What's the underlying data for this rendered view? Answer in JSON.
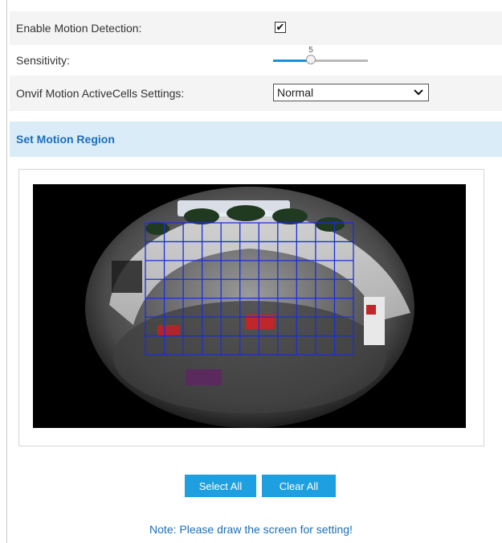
{
  "settings": {
    "motion_detection": {
      "label": "Enable Motion Detection:",
      "checked": true,
      "check_glyph": "✔"
    },
    "sensitivity": {
      "label": "Sensitivity:",
      "value": "5",
      "fraction": 0.4
    },
    "onvif_cells": {
      "label": "Onvif Motion ActiveCells Settings:",
      "selected": "Normal"
    }
  },
  "region": {
    "title": "Set Motion Region",
    "grid": {
      "cols": 11,
      "rows": 7,
      "color": "#1a2fd6"
    }
  },
  "buttons": {
    "select_all": "Select All",
    "clear_all": "Clear All"
  },
  "note": "Note: Please draw the screen for setting!",
  "colors": {
    "accent": "#1e9fe0",
    "heading": "#1b6fb8",
    "section_bg": "#d9ecf8"
  }
}
